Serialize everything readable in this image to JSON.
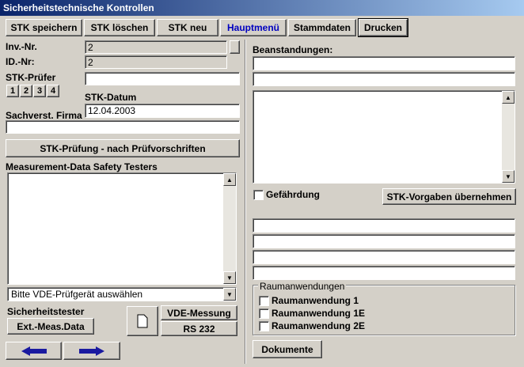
{
  "window": {
    "title": "Sicherheitstechnische Kontrollen"
  },
  "toolbar": {
    "save": "STK speichern",
    "delete": "STK löschen",
    "new": "STK neu",
    "main_menu": "Hauptmenü",
    "master_data": "Stammdaten",
    "print": "Drucken",
    "main_menu_color": "#0000c0"
  },
  "left": {
    "inv_label": "Inv.-Nr.",
    "inv_value": "2",
    "id_label": "ID.-Nr:",
    "id_value": "2",
    "pruefer_label": "STK-Prüfer",
    "pruefer_value": "",
    "num_buttons": [
      "1",
      "2",
      "3",
      "4"
    ],
    "datum_label": "STK-Datum",
    "datum_value": "12.04.2003",
    "firma_label": "Sachverst. Firma",
    "firma_value": "",
    "pruefung_button": "STK-Prüfung - nach Prüfvorschriften",
    "measurement_label": "Measurement-Data Safety Testers",
    "device_select": "Bitte VDE-Prüfgerät auswählen",
    "tester_label": "Sicherheitstester",
    "ext_meas_button": "Ext.-Meas.Data",
    "vde_button": "VDE-Messung",
    "rs232_button": "RS 232"
  },
  "right": {
    "beanstandungen_label": "Beanstandungen:",
    "gefaehrdung_label": "Gefährdung",
    "gefaehrdung_checked": false,
    "vorgaben_button": "STK-Vorgaben übernehmen",
    "raum_group_label": "Raumanwendungen",
    "raum_items": [
      {
        "label": "Raumanwendung 1",
        "checked": false
      },
      {
        "label": "Raumanwendung 1E",
        "checked": false
      },
      {
        "label": "Raumanwendung 2E",
        "checked": false
      }
    ],
    "dokumente_button": "Dokumente"
  },
  "icons": {
    "prev": "arrow-left-icon",
    "next": "arrow-right-icon",
    "doc": "document-icon",
    "arrow_color": "#1a1aa0"
  }
}
